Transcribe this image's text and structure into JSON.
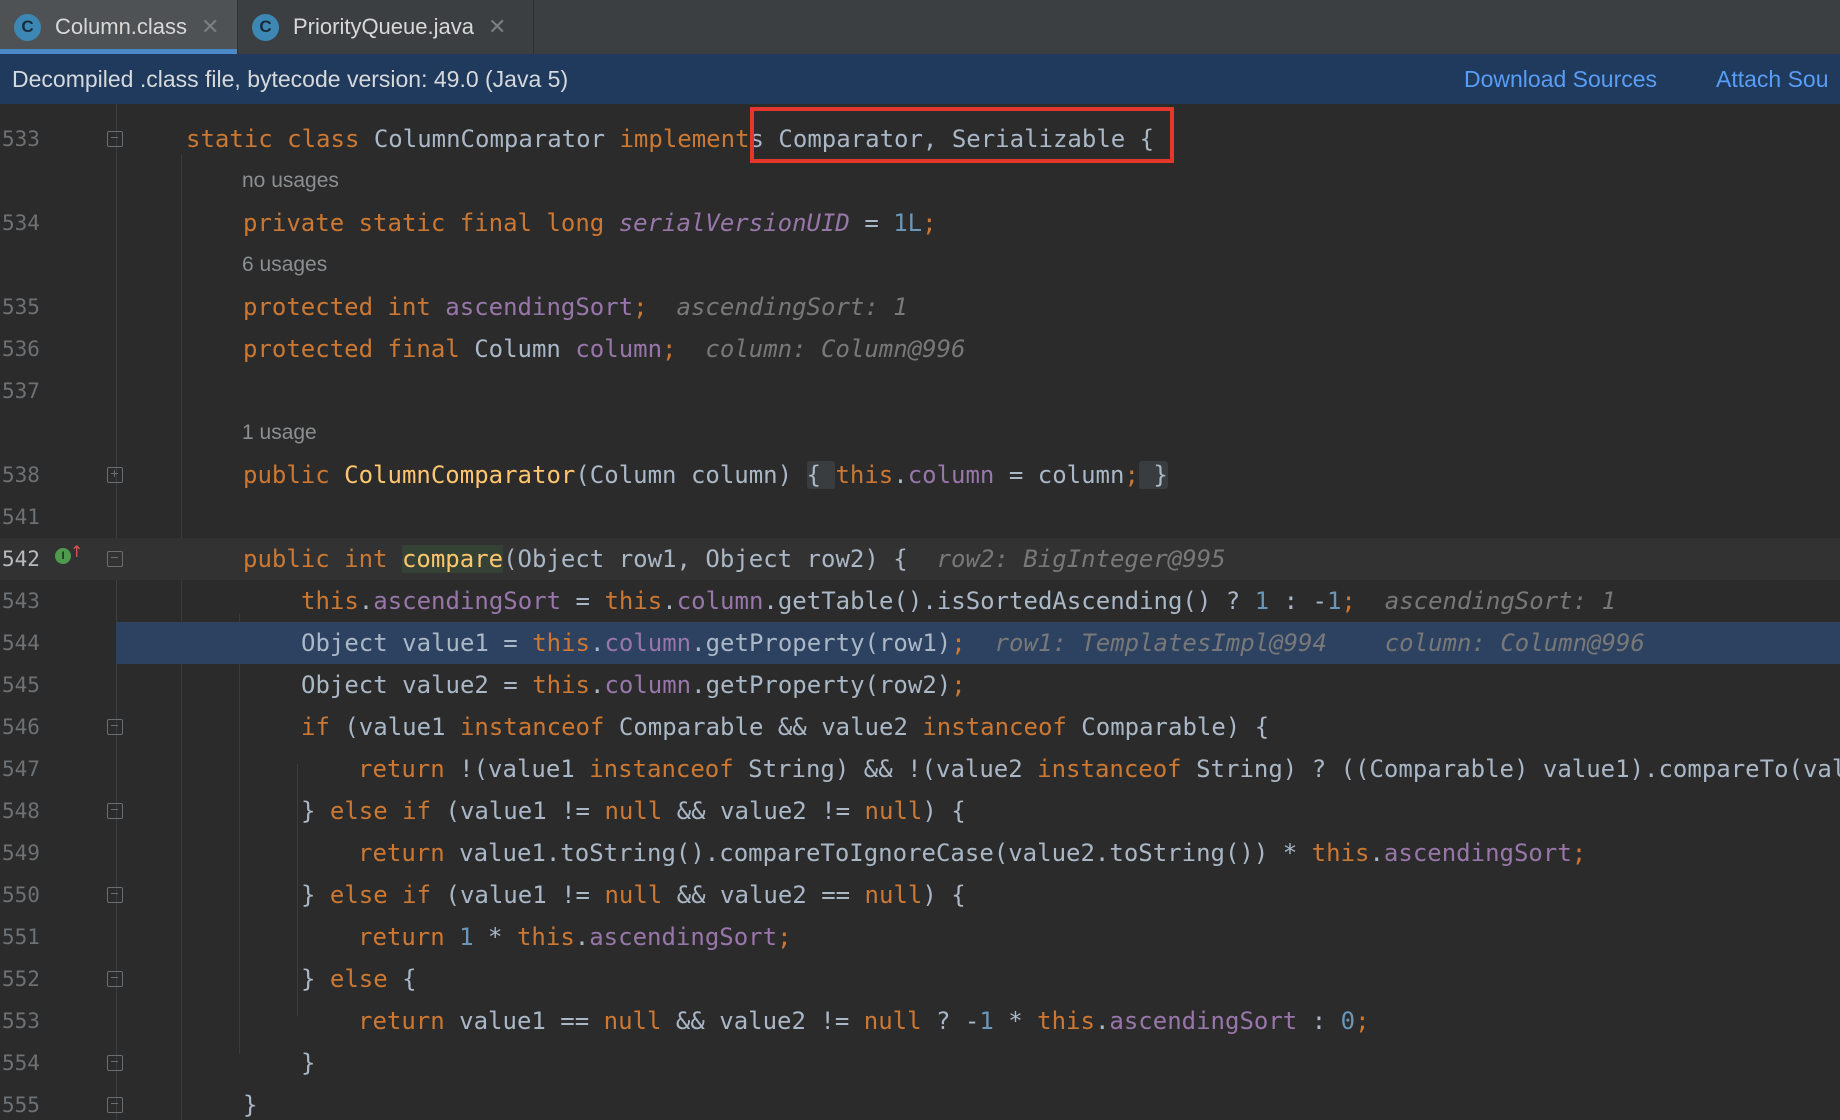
{
  "tabs": [
    {
      "icon": "C",
      "label": "Column.class",
      "active": true
    },
    {
      "icon": "C",
      "label": "PriorityQueue.java",
      "active": false
    }
  ],
  "banner": {
    "text": "Decompiled .class file, bytecode version: 49.0 (Java 5)",
    "download_sources": "Download Sources",
    "attach_sources": "Attach Sou"
  },
  "line_numbers": {
    "l533": "533",
    "l534": "534",
    "l535": "535",
    "l536": "536",
    "l537": "537",
    "l538": "538",
    "l541": "541",
    "l542": "542",
    "l543": "543",
    "l544": "544",
    "l545": "545",
    "l546": "546",
    "l547": "547",
    "l548": "548",
    "l549": "549",
    "l550": "550",
    "l551": "551",
    "l552": "552",
    "l553": "553",
    "l554": "554",
    "l555": "555"
  },
  "usages": {
    "serial": "no usages",
    "ascending": "6 usages",
    "ctor": "1 usage"
  },
  "code": {
    "l533": {
      "kw1": "static class ",
      "name": "ColumnComparator ",
      "kw2": "implement",
      "rest": "s Comparator, Serializable {"
    },
    "l534": {
      "kw": "private static final long ",
      "fld": "serialVersionUID",
      "eq": " = ",
      "num": "1L",
      "semi": ";"
    },
    "l535": {
      "kw": "protected int ",
      "fld": "ascendingSort",
      "semi": ";",
      "hint": "ascendingSort: 1"
    },
    "l536": {
      "kw": "protected final ",
      "type": "Column ",
      "fld": "column",
      "semi": ";",
      "hint": "column: Column@996"
    },
    "l538": {
      "kw": "public ",
      "fn": "ColumnComparator",
      "params": "(Column column) ",
      "b1": "{ ",
      "this": "this",
      "dot": ".",
      "fld": "column",
      "assign": " = column",
      "semi": ";",
      "b2": " }"
    },
    "l542": {
      "kw": "public int ",
      "fn": "compare",
      "params": "(Object row1, Object row2) {",
      "hint": "row2: BigInteger@995"
    },
    "l543": {
      "this1": "this",
      "fld1": "ascendingSort",
      "mid": " = ",
      "this2": "this",
      "fld2": "column",
      "call": ".getTable().isSortedAscending() ? ",
      "n1": "1",
      "colon": " : -",
      "n2": "1",
      "semi": ";",
      "hint": "ascendingSort: 1"
    },
    "l544": {
      "pre": "Object value1 = ",
      "this": "this",
      "fld": "column",
      "call": ".getProperty(row1)",
      "semi": ";",
      "hint1": "row1: TemplatesImpl@994",
      "hint2": "column: Column@996"
    },
    "l545": {
      "pre": "Object value2 = ",
      "this": "this",
      "fld": "column",
      "call": ".getProperty(row2)",
      "semi": ";"
    },
    "l546": {
      "kw1": "if ",
      "a": "(value1 ",
      "kw2": "instanceof ",
      "b": "Comparable && value2 ",
      "kw3": "instanceof ",
      "c": "Comparable) {"
    },
    "l547": {
      "kw1": "return ",
      "a": "!(value1 ",
      "kw2": "instanceof ",
      "b": "String) && !(value2 ",
      "kw3": "instanceof ",
      "c": "String) ? ((Comparable) value1).compareTo(val"
    },
    "l548": {
      "a": "} ",
      "kw1": "else if ",
      "b": "(value1 != ",
      "kw2": "null",
      "c": " && value2 != ",
      "kw3": "null",
      "d": ") {"
    },
    "l549": {
      "kw": "return ",
      "a": "value1.toString().compareToIgnoreCase(value2.toString()) * ",
      "this": "this",
      "fld": "ascendingSort",
      "semi": ";"
    },
    "l550": {
      "a": "} ",
      "kw1": "else if ",
      "b": "(value1 != ",
      "kw2": "null",
      "c": " && value2 == ",
      "kw3": "null",
      "d": ") {"
    },
    "l551": {
      "kw": "return ",
      "num": "1",
      "a": " * ",
      "this": "this",
      "fld": "ascendingSort",
      "semi": ";"
    },
    "l552": {
      "a": "} ",
      "kw": "else ",
      "b": "{"
    },
    "l553": {
      "kw": "return ",
      "a": "value1 == ",
      "kw2": "null",
      "b": " && value2 != ",
      "kw3": "null",
      "c": " ? -",
      "n1": "1",
      "d": " * ",
      "this": "this",
      "fld": "ascendingSort",
      "e": " : ",
      "n2": "0",
      "semi": ";"
    },
    "l554": {
      "a": "}"
    },
    "l555": {
      "a": "}"
    }
  },
  "colors": {
    "background": "#2b2b2b",
    "keyword": "#cc7832",
    "field": "#9876aa",
    "number": "#6897bb",
    "function": "#ffc66d",
    "selected_line": "#2d4260",
    "banner": "#1f3a5c",
    "highlight_box": "#e2372a"
  }
}
